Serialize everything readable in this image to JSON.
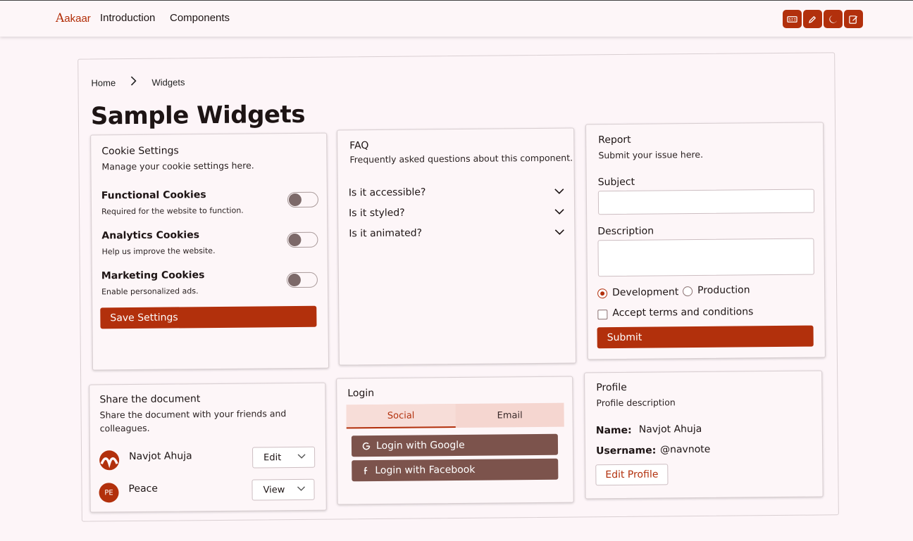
{
  "topbar": {
    "brand": "akaar",
    "brand_initial": "A",
    "nav": [
      "Introduction",
      "Components"
    ],
    "buttons": [
      {
        "name": "rtl-toggle-icon"
      },
      {
        "name": "theme-customizer-icon"
      },
      {
        "name": "dark-mode-icon"
      },
      {
        "name": "edit-page-icon"
      }
    ]
  },
  "breadcrumb": {
    "home": "Home",
    "current": "Widgets"
  },
  "page_title": "Sample Widgets",
  "cookie": {
    "title": "Cookie Settings",
    "subtitle": "Manage your cookie settings here.",
    "items": [
      {
        "label": "Functional Cookies",
        "desc": "Required for the website to function.",
        "on": false
      },
      {
        "label": "Analytics Cookies",
        "desc": "Help us improve the website.",
        "on": false
      },
      {
        "label": "Marketing Cookies",
        "desc": "Enable personalized ads.",
        "on": false
      }
    ],
    "save_label": "Save Settings"
  },
  "faq": {
    "title": "FAQ",
    "subtitle": "Frequently asked questions about this component.",
    "items": [
      "Is it accessible?",
      "Is it styled?",
      "Is it animated?"
    ]
  },
  "report": {
    "title": "Report",
    "subtitle": "Submit your issue here.",
    "subject_label": "Subject",
    "subject_value": "",
    "description_label": "Description",
    "description_value": "",
    "env_options": [
      "Development",
      "Production"
    ],
    "env_selected": "Development",
    "terms_label": "Accept terms and conditions",
    "terms_checked": false,
    "submit_label": "Submit"
  },
  "share": {
    "title": "Share the document",
    "subtitle_1": "Share the document with your friends and",
    "subtitle_2": "colleagues.",
    "people": [
      {
        "name": "Navjot Ahuja",
        "permission": "Edit",
        "initials": ""
      },
      {
        "name": "Peace",
        "permission": "View",
        "initials": "PE"
      }
    ]
  },
  "login": {
    "title": "Login",
    "tabs": [
      "Social",
      "Email"
    ],
    "active_tab": "Social",
    "google_label": "Login with Google",
    "facebook_label": "Login with Facebook"
  },
  "profile": {
    "title": "Profile",
    "subtitle": "Profile description",
    "name_label": "Name:",
    "name_value": "Navjot Ahuja",
    "username_label": "Username:",
    "username_value": "@navnote",
    "edit_label": "Edit Profile"
  },
  "colors": {
    "accent": "#b2300c",
    "social_button": "#7c534c",
    "tab_bg": "#f5d6d0",
    "page_bg": "#fdf5f8"
  }
}
